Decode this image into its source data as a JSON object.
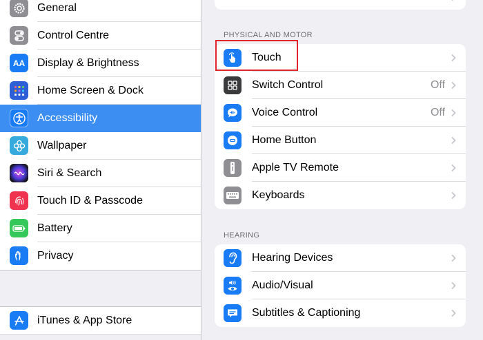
{
  "sidebar": {
    "items": [
      {
        "label": "General"
      },
      {
        "label": "Control Centre"
      },
      {
        "label": "Display & Brightness"
      },
      {
        "label": "Home Screen & Dock"
      },
      {
        "label": "Accessibility"
      },
      {
        "label": "Wallpaper"
      },
      {
        "label": "Siri & Search"
      },
      {
        "label": "Touch ID & Passcode"
      },
      {
        "label": "Battery"
      },
      {
        "label": "Privacy"
      }
    ],
    "store_item": {
      "label": "iTunes & App Store"
    },
    "selected": "Accessibility"
  },
  "detail": {
    "physical_motor": {
      "header": "PHYSICAL AND MOTOR",
      "rows": [
        {
          "label": "Touch",
          "value": ""
        },
        {
          "label": "Switch Control",
          "value": "Off"
        },
        {
          "label": "Voice Control",
          "value": "Off"
        },
        {
          "label": "Home Button",
          "value": ""
        },
        {
          "label": "Apple TV Remote",
          "value": ""
        },
        {
          "label": "Keyboards",
          "value": ""
        }
      ]
    },
    "hearing": {
      "header": "HEARING",
      "rows": [
        {
          "label": "Hearing Devices"
        },
        {
          "label": "Audio/Visual"
        },
        {
          "label": "Subtitles & Captioning"
        }
      ]
    }
  },
  "colors": {
    "selection": "#3c8ef3",
    "highlight_box": "#e0262a",
    "accent_blue": "#1a7cf5"
  }
}
